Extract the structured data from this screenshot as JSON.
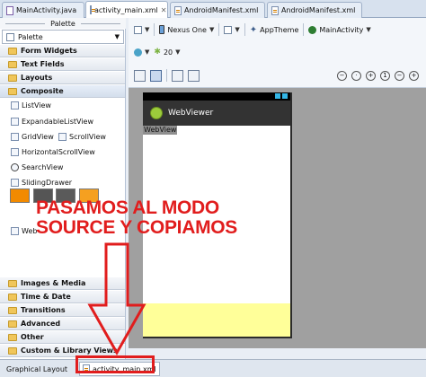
{
  "editor_tabs": [
    {
      "label": "MainActivity.java",
      "kind": "java"
    },
    {
      "label": "activity_main.xml",
      "kind": "xml",
      "active": true
    },
    {
      "label": "AndroidManifest.xml",
      "kind": "xml"
    },
    {
      "label": "AndroidManifest.xml",
      "kind": "xml"
    }
  ],
  "palette": {
    "title": "Palette",
    "dropdown": "Palette",
    "categories_top": [
      "Form Widgets",
      "Text Fields",
      "Layouts",
      "Composite"
    ],
    "composite_items": [
      "ListView",
      "ExpandableListView",
      "GridView",
      "ScrollView",
      "HorizontalScrollView",
      "SearchView",
      "SlidingDrawer",
      "Web"
    ],
    "swatch_colors": [
      "#f28a00",
      "#555555",
      "#5a5a5a",
      "#f5a020"
    ],
    "categories_bottom": [
      "Images & Media",
      "Time & Date",
      "Transitions",
      "Advanced",
      "Other",
      "Custom & Library Views"
    ]
  },
  "toolbar": {
    "device": "Nexus One",
    "theme": "AppTheme",
    "activity": "MainActivity",
    "api_level": "20"
  },
  "preview": {
    "app_title": "WebViewer",
    "widget_label": "WebView",
    "highlight_color": "#ffff99"
  },
  "bottom_tabs": [
    "Graphical Layout",
    "activity_main.xml"
  ],
  "annotation": {
    "line1": "PASAMOS AL MODO",
    "line2": "SOURCE Y COPIAMOS",
    "color": "#e11d1d"
  }
}
